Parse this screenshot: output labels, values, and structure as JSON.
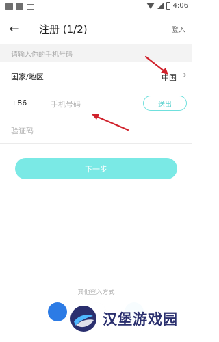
{
  "status_bar": {
    "time": "4:06",
    "icons": [
      "app-icon",
      "app-icon",
      "keyboard-icon",
      "wifi-icon",
      "signal-icon",
      "battery-icon"
    ]
  },
  "app_bar": {
    "back_icon": "arrow-left-icon",
    "title": "注册 (1/2)",
    "login_label": "登入"
  },
  "form": {
    "hint": "请输入你的手机号码",
    "country_label": "国家/地区",
    "country_value": "中国",
    "country_code": "+86",
    "phone_placeholder": "手机号码",
    "phone_value": "",
    "send_label": "送出",
    "code_placeholder": "验证码",
    "code_value": ""
  },
  "next_button": {
    "label": "下一步"
  },
  "other_login": {
    "label": "其他登入方式"
  },
  "social": [
    "facebook-icon",
    "google-icon",
    "twitter-icon"
  ],
  "watermark": {
    "text": "汉堡游戏园"
  },
  "colors": {
    "accent": "#7ae9e5",
    "accent_border": "#6fe0dd",
    "annotation": "#d0212b"
  }
}
